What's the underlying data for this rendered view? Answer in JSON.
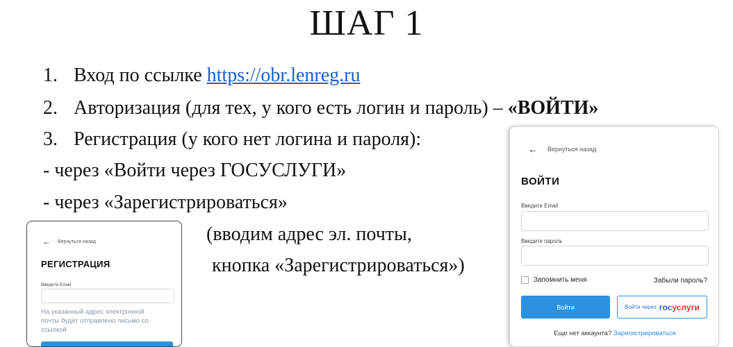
{
  "slide": {
    "title": "ШАГ 1",
    "items": [
      {
        "num": "1.",
        "text": "Вход по ссылке ",
        "link": "https://obr.lenreg.ru"
      },
      {
        "num": "2.",
        "text": "Авторизация (для тех, у кого есть логин и пароль) – ",
        "bold": "«ВОЙТИ»"
      },
      {
        "num": "3.",
        "text": "Регистрация (у кого нет логина и пароля):"
      }
    ],
    "dash_lines": [
      "- через «Войти через ГОСУСЛУГИ»",
      "- через «Зарегистрироваться»"
    ],
    "note_lines": [
      "(вводим адрес эл. почты,",
      "кнопка «Зарегистрироваться»)"
    ]
  },
  "registration_card": {
    "back_label": "Вернуться назад",
    "heading": "РЕГИСТРАЦИЯ",
    "email_label": "Введите Email",
    "hint": "На указанный адрес электронной почты будет отправлено письмо со ссылкой"
  },
  "login_card": {
    "back_label": "Вернуться назад",
    "heading": "ВОЙТИ",
    "email_label": "Введите Email",
    "password_label": "Введите пароль",
    "remember_label": "Запомнить меня",
    "forgot_label": "Забыли пароль?",
    "login_button": "Войти",
    "gosuslugi_prefix": "Войти через",
    "gosuslugi_brand_a": "гос",
    "gosuslugi_brand_b": "услуги",
    "no_account_text": "Еще нет аккаунта?",
    "register_link": "Зарегистрироваться"
  },
  "colors": {
    "accent": "#2b92e0",
    "link": "#1a5fc9",
    "brand_blue": "#1f62c4",
    "brand_red": "#e0352b"
  },
  "icons": [
    "back-arrow-icon",
    "checkbox-icon"
  ]
}
